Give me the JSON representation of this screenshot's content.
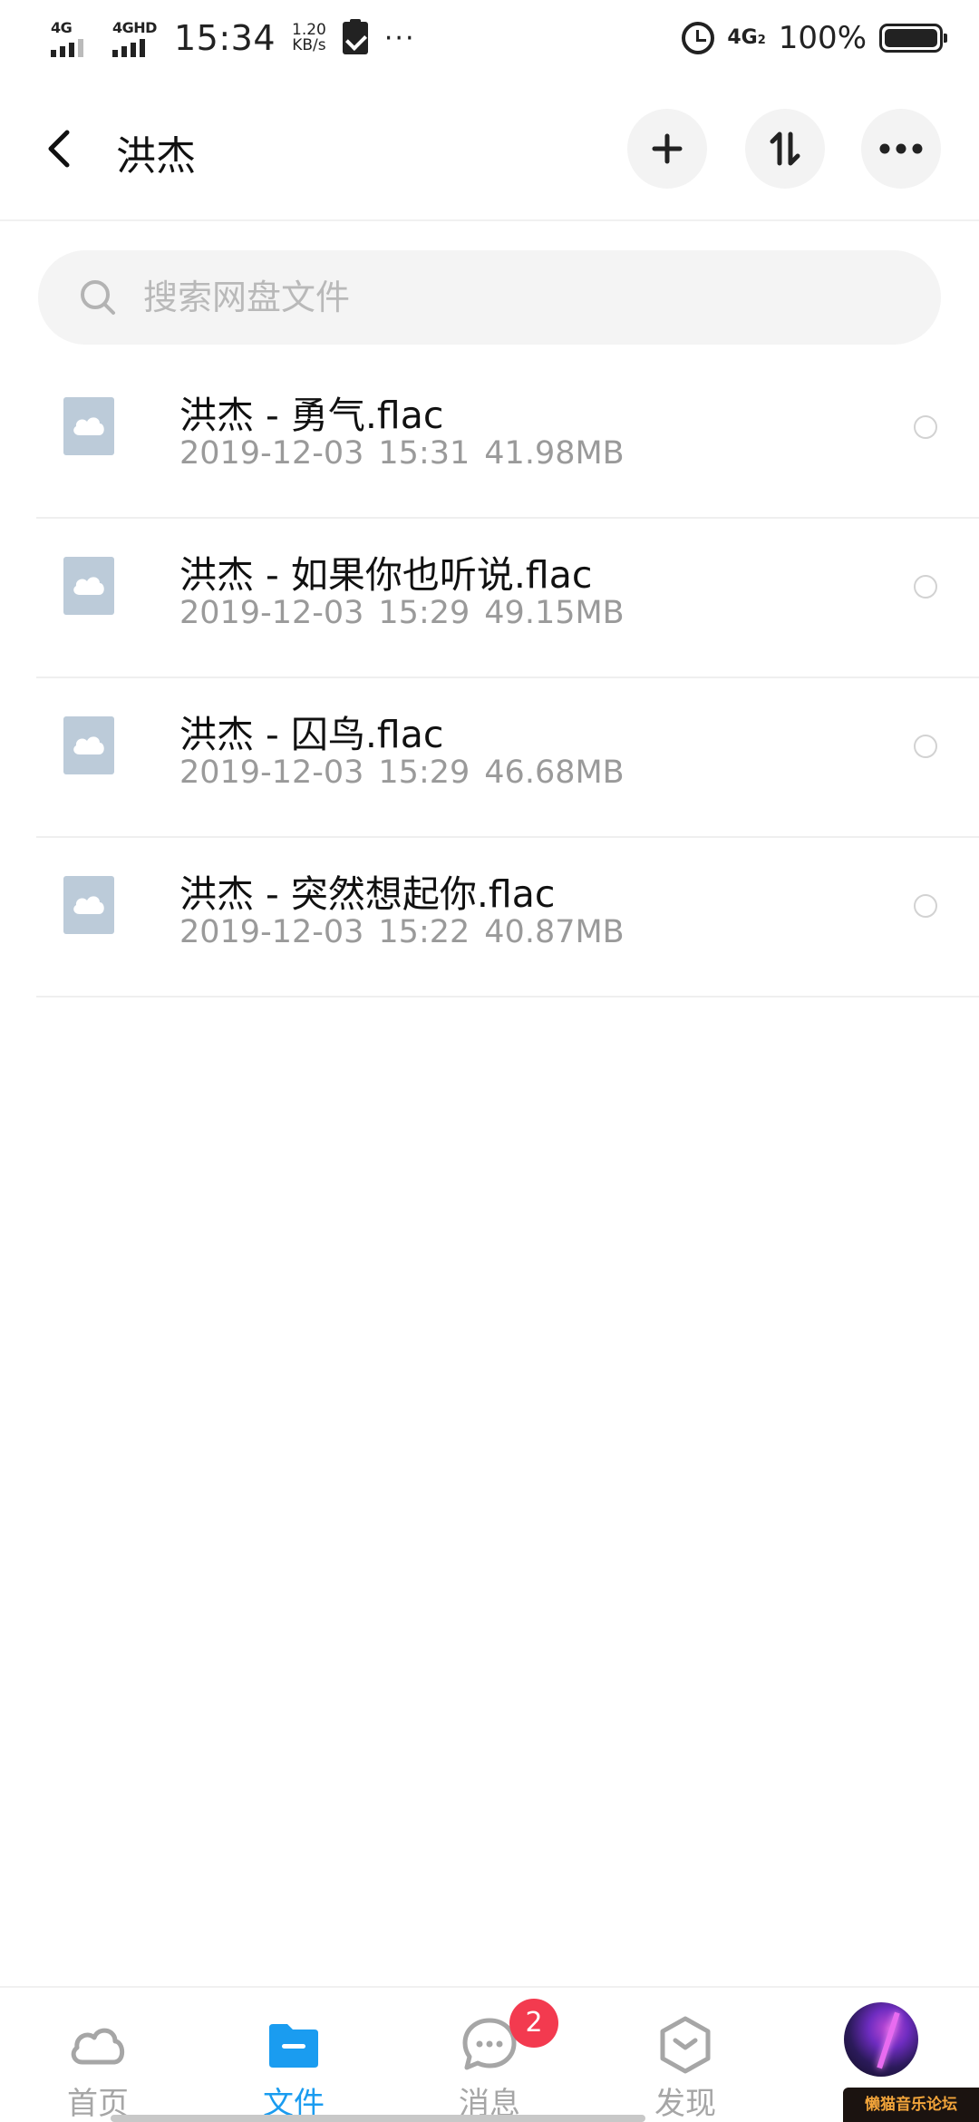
{
  "status_bar": {
    "sim1_label": "4G",
    "sim2_label": "4GHD",
    "time": "15:34",
    "speed_value": "1.20",
    "speed_unit": "KB/s",
    "more": "···",
    "network": "4G",
    "network_sub": "2",
    "battery": "100%"
  },
  "header": {
    "title": "洪杰",
    "actions": [
      "add-icon",
      "transfer-icon",
      "more-icon"
    ]
  },
  "search": {
    "placeholder": "搜索网盘文件"
  },
  "files": [
    {
      "name": "洪杰 - 勇气.flac",
      "date": "2019-12-03",
      "time": "15:31",
      "size": "41.98MB"
    },
    {
      "name": "洪杰 - 如果你也听说.flac",
      "date": "2019-12-03",
      "time": "15:29",
      "size": "49.15MB"
    },
    {
      "name": "洪杰 - 囚鸟.flac",
      "date": "2019-12-03",
      "time": "15:29",
      "size": "46.68MB"
    },
    {
      "name": "洪杰 - 突然想起你.flac",
      "date": "2019-12-03",
      "time": "15:22",
      "size": "40.87MB"
    }
  ],
  "bottom_nav": {
    "items": [
      {
        "label": "首页",
        "icon": "cloud-icon"
      },
      {
        "label": "文件",
        "icon": "folder-icon",
        "active": true
      },
      {
        "label": "消息",
        "icon": "message-icon",
        "badge": "2"
      },
      {
        "label": "发现",
        "icon": "discover-icon"
      },
      {
        "label": "",
        "icon": "avatar"
      }
    ]
  },
  "watermark": "懒猫音乐论坛",
  "colors": {
    "accent": "#1a9cf0",
    "badge": "#f33a4f",
    "file_icon": "#bccbd9"
  }
}
